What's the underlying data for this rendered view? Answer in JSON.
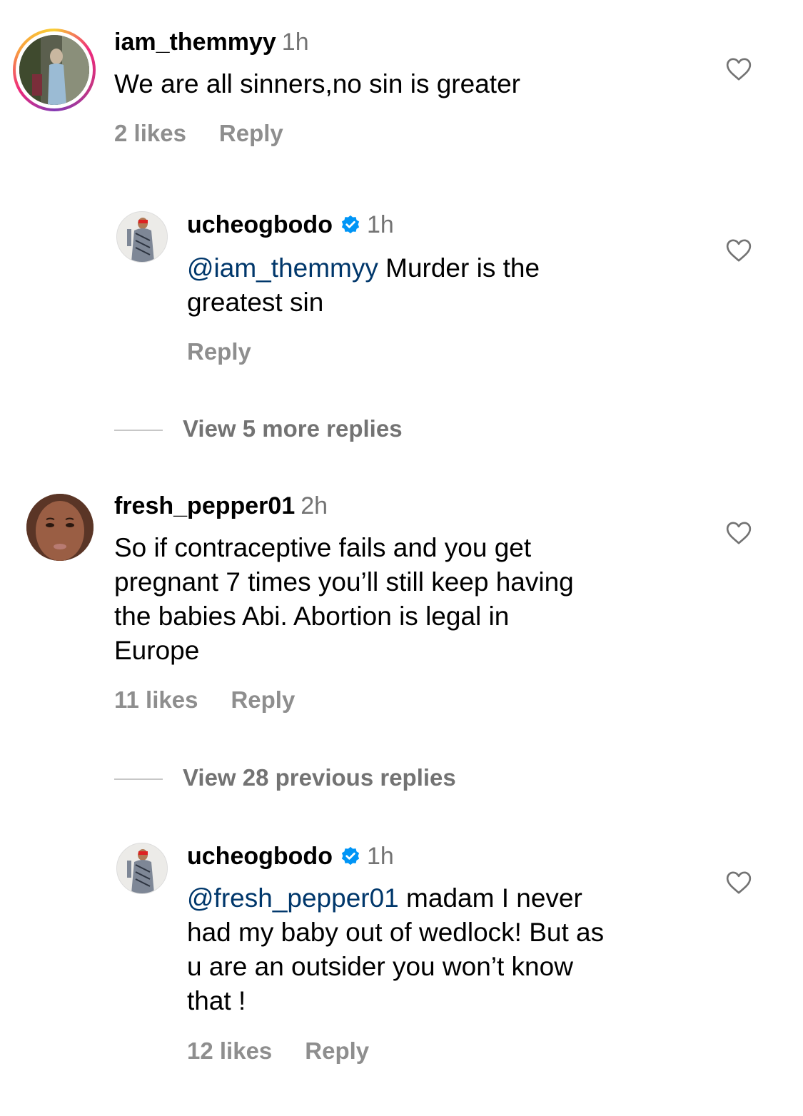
{
  "comments": [
    {
      "username": "iam_themmyy",
      "time": "1h",
      "text": "We are all sinners,no sin is greater",
      "likes": "2 likes",
      "reply": "Reply",
      "avatar_icon": "avatar-with-story-ring"
    },
    {
      "username": "ucheogbodo",
      "verified": true,
      "time": "1h",
      "mention": "@iam_themmyy",
      "text_line1_rest": " Murder is the",
      "text_line2": "greatest sin",
      "reply": "Reply"
    },
    {
      "username": "fresh_pepper01",
      "time": "2h",
      "text_lines": [
        "So if contraceptive fails and you get",
        "pregnant 7 times you’ll still keep having",
        "the babies Abi. Abortion is legal in",
        "Europe"
      ],
      "likes": "11 likes",
      "reply": "Reply"
    },
    {
      "username": "ucheogbodo",
      "verified": true,
      "time": "1h",
      "mention": "@fresh_pepper01",
      "text_line1_rest": " madam I never",
      "text_lines_rest": [
        "had my baby out of wedlock! But as",
        "u are an outsider you won’t know",
        "that !"
      ],
      "likes": "12 likes",
      "reply": "Reply"
    }
  ],
  "view_more_1": "View 5 more replies",
  "view_more_2": "View 28 previous replies",
  "colors": {
    "mention": "#00376b",
    "verified": "#0095f6",
    "meta": "#8e8e8e"
  }
}
